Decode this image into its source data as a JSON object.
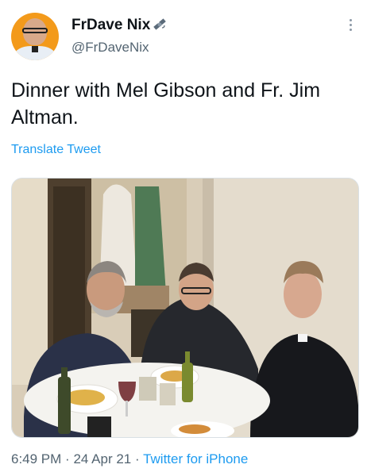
{
  "tweet": {
    "display_name": "FrDave Nix",
    "handle": "@FrDaveNix",
    "text": "Dinner with Mel Gibson and Fr. Jim Altman.",
    "translate_label": "Translate Tweet",
    "time": "6:49 PM",
    "separator": "·",
    "date": "24 Apr 21",
    "source": "Twitter for iPhone"
  },
  "icons": {
    "verified_badge": "satellite-icon",
    "more": "more-icon"
  },
  "colors": {
    "link": "#1d9bf0",
    "secondary_text": "#536471",
    "primary_text": "#0f1419",
    "avatar_bg": "#f39a1b"
  }
}
